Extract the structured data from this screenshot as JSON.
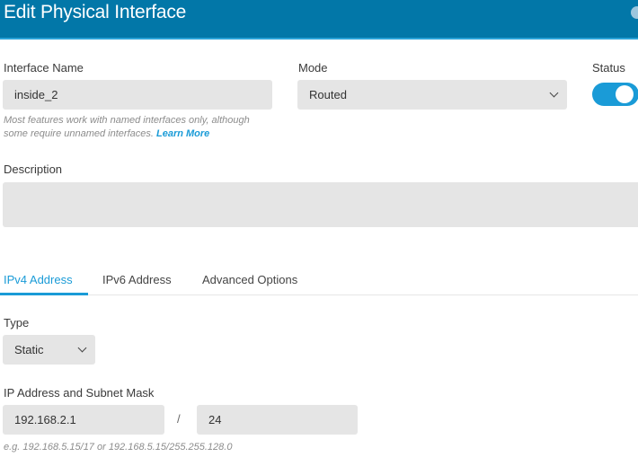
{
  "dialog": {
    "title": "Edit Physical Interface"
  },
  "interface_name": {
    "label": "Interface Name",
    "value": "inside_2",
    "help_text": "Most features work with named interfaces only, although",
    "help_text_2": "some require unnamed interfaces.",
    "learn_more": "Learn More"
  },
  "mode": {
    "label": "Mode",
    "selected": "Routed"
  },
  "status": {
    "label": "Status",
    "enabled": true
  },
  "description": {
    "label": "Description",
    "value": ""
  },
  "tabs": [
    {
      "label": "IPv4 Address",
      "active": true
    },
    {
      "label": "IPv6 Address",
      "active": false
    },
    {
      "label": "Advanced Options",
      "active": false
    }
  ],
  "ipv4": {
    "type_label": "Type",
    "type_selected": "Static",
    "ip_label": "IP Address and Subnet Mask",
    "ip_value": "192.168.2.1",
    "separator": "/",
    "mask_value": "24",
    "example": "e.g. 192.168.5.15/17 or 192.168.5.15/255.255.128.0"
  },
  "colors": {
    "header": "#0277a8",
    "accent": "#1a9bd7",
    "field_bg": "#e5e5e5"
  }
}
